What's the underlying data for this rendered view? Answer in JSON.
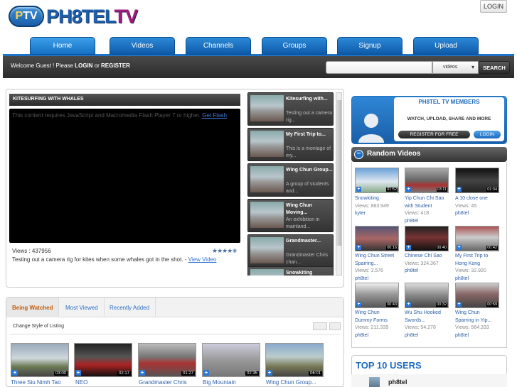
{
  "header": {
    "logo_badge": "P",
    "logo_badge_b": "TV",
    "logo_text_a": "PH8TEL",
    "logo_text_b": "TV",
    "login": "LOGIN"
  },
  "nav": {
    "tabs": [
      "Home",
      "Videos",
      "Channels",
      "Groups",
      "Signup",
      "Upload"
    ],
    "active": "Home"
  },
  "welcome": {
    "prefix": "Welcome Guest ! Please ",
    "login": "LOGIN",
    "or": " or ",
    "register": "REGISTER"
  },
  "search": {
    "placeholder": "",
    "category": "videos",
    "button": "SEARCH"
  },
  "featured": {
    "title": "KITESURFING WITH WHALES",
    "flash_msg": "This content requires JavaScript and Macromedia Flash Player 7 or higher. ",
    "flash_link": "Get Flash",
    "views": "Views : 437956",
    "description": "Testing out a camera rig for kites when some whales got in the shot. - ",
    "view_link": "View Video",
    "rating": 4.5
  },
  "side_videos": [
    {
      "title": "Kitesurfing with...",
      "desc": "Testing out a camera rig..."
    },
    {
      "title": "My First Trip to...",
      "desc": "This is a montage of my..."
    },
    {
      "title": "Wing Chun Group...",
      "desc": "A group of students and..."
    },
    {
      "title": "Wing Chun Moving...",
      "desc": "An exhibition in mainland..."
    },
    {
      "title": "Grandmaster...",
      "desc": "Grandmaster Chris chan..."
    },
    {
      "title": "Snowkiting",
      "desc": ""
    }
  ],
  "listing": {
    "tabs": [
      "Being Watched",
      "Most Viewed",
      "Recently Added"
    ],
    "active": "Being Watched",
    "change_style": "Change Style of Listing",
    "videos": [
      {
        "title": "Three Siu Nimh Tao",
        "duration": "03:00"
      },
      {
        "title": "NEO",
        "duration": "02:17"
      },
      {
        "title": "Grandmaster Chris",
        "duration": "01:27"
      },
      {
        "title": "Big Mountain",
        "duration": "02:35"
      },
      {
        "title": "Wing Chun Group...",
        "duration": "06:01"
      }
    ]
  },
  "members": {
    "title": "PH8TEL TV MEMBERS",
    "subtitle": "WATCH, UPLOAD, SHARE AND MORE",
    "register": "REGISTER FOR FREE",
    "login": "LOGIN"
  },
  "random": {
    "title": "Random Videos",
    "videos": [
      {
        "title": "Snowkiting",
        "title2": "",
        "views": "Views: 883.949",
        "user": "kyter",
        "duration": "01:52"
      },
      {
        "title": "Yip Chun Chi Sao",
        "title2": "with Student",
        "views": "Views: 418",
        "user": "ph8tel",
        "duration": "03:11"
      },
      {
        "title": "A 10 close one",
        "title2": "",
        "views": "Views: 45",
        "user": "ph8tel",
        "duration": "01:34"
      },
      {
        "title": "Wing Chun Street",
        "title2": "Sparring...",
        "views": "Views: 3.576",
        "user": "ph8tel",
        "duration": "00:16"
      },
      {
        "title": "Chinese Chi Sao",
        "title2": "",
        "views": "Views: 324.367",
        "user": "ph8tel",
        "duration": "00:40"
      },
      {
        "title": "My First Trip to",
        "title2": "Hong Kong",
        "views": "Views: 32.920",
        "user": "ph8tel",
        "duration": "00:42"
      },
      {
        "title": "Wing Chun",
        "title2": "Dummy Forms",
        "views": "Views: 211.339",
        "user": "ph8tel",
        "duration": "00:43"
      },
      {
        "title": "Wu Shu Hooked",
        "title2": "Swords...",
        "views": "Views: 54.278",
        "user": "ph8tel",
        "duration": "00:32"
      },
      {
        "title": "Wing Chun",
        "title2": "Sparring in Yip...",
        "views": "Views: 564.333",
        "user": "ph8tel",
        "duration": "00:59"
      }
    ]
  },
  "top10": {
    "title": "TOP 10 USERS",
    "first_user": "ph8tel"
  },
  "colors": {
    "accent": "#1e6fc4",
    "nav_dark": "#2b2b2b",
    "link": "#2b5fa8",
    "active_tab": "#c35a0a"
  }
}
